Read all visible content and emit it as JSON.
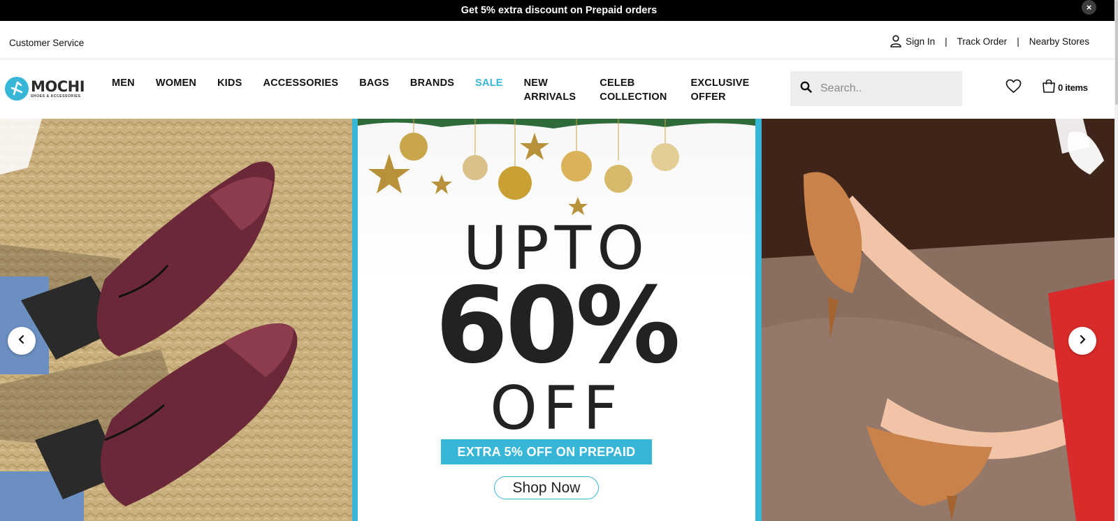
{
  "announcement": {
    "text": "Get 5% extra discount on Prepaid orders",
    "close_icon": "×"
  },
  "utility": {
    "customer_service": "Customer Service",
    "sign_in": "Sign In",
    "separator": "|",
    "track_order": "Track Order",
    "nearby_stores": "Nearby Stores"
  },
  "header": {
    "logo": {
      "word": "MOCHI",
      "tagline": "SHOES & ACCESSORIES"
    },
    "nav": [
      {
        "line1": "MEN",
        "line2": ""
      },
      {
        "line1": "WOMEN",
        "line2": ""
      },
      {
        "line1": "KIDS",
        "line2": ""
      },
      {
        "line1": "ACCESSORIES",
        "line2": ""
      },
      {
        "line1": "BAGS",
        "line2": ""
      },
      {
        "line1": "BRANDS",
        "line2": ""
      },
      {
        "line1": "SALE",
        "line2": ""
      },
      {
        "line1": "NEW",
        "line2": "ARRIVALS"
      },
      {
        "line1": "CELEB",
        "line2": "COLLECTION"
      },
      {
        "line1": "EXCLUSIVE",
        "line2": "OFFER"
      }
    ],
    "search_placeholder": "Search..",
    "cart_label": "0 items"
  },
  "hero": {
    "upto": "UPTO",
    "percent": "60%",
    "off": "OFF",
    "extra": "EXTRA 5% OFF ON PREPAID",
    "cta": "Shop Now"
  },
  "colors": {
    "accent": "#38b6d8",
    "announce_bg": "#000000",
    "search_bg": "#ededed"
  },
  "icons": [
    "close-icon",
    "user-icon",
    "search-icon",
    "heart-icon",
    "cart-icon",
    "chevron-left-icon",
    "chevron-right-icon"
  ]
}
